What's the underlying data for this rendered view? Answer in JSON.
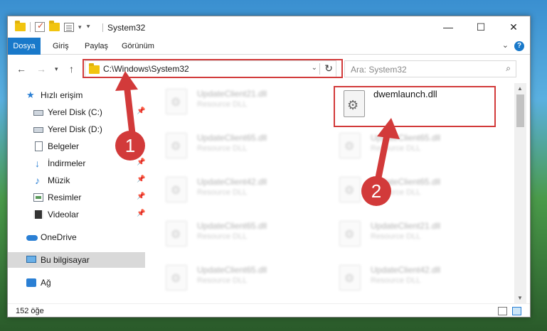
{
  "window": {
    "title": "System32"
  },
  "ribbon": {
    "tabs": [
      "Dosya",
      "Giriş",
      "Paylaş",
      "Görünüm"
    ]
  },
  "address": {
    "path": "C:\\Windows\\System32"
  },
  "search": {
    "placeholder": "Ara: System32"
  },
  "sidebar": {
    "items": [
      {
        "label": "Hızlı erişim",
        "icon": "star-icon"
      },
      {
        "label": "Yerel Disk (C:)",
        "icon": "disk-icon"
      },
      {
        "label": "Yerel Disk (D:)",
        "icon": "disk-icon"
      },
      {
        "label": "Belgeler",
        "icon": "document-icon"
      },
      {
        "label": "İndirmeler",
        "icon": "download-icon"
      },
      {
        "label": "Müzik",
        "icon": "music-icon"
      },
      {
        "label": "Resimler",
        "icon": "pictures-icon"
      },
      {
        "label": "Videolar",
        "icon": "video-icon"
      },
      {
        "label": "OneDrive",
        "icon": "cloud-icon"
      },
      {
        "label": "Bu bilgisayar",
        "icon": "computer-icon"
      },
      {
        "label": "Ağ",
        "icon": "network-icon"
      }
    ]
  },
  "files": {
    "left": [
      {
        "name": "UpdateClient21.dll",
        "type": "Resource DLL"
      },
      {
        "name": "UpdateClient65.dll",
        "type": "Resource DLL"
      },
      {
        "name": "UpdateClient42.dll",
        "type": "Resource DLL"
      },
      {
        "name": "UpdateClient65.dll",
        "type": "Resource DLL"
      },
      {
        "name": "UpdateClient65.dll",
        "type": "Resource DLL"
      }
    ],
    "right": [
      {
        "name": "UpdateClient65.dll",
        "type": "Resource DLL"
      },
      {
        "name": "UpdateClient65.dll",
        "type": "Resource DLL"
      },
      {
        "name": "UpdateClient21.dll",
        "type": "Resource DLL"
      },
      {
        "name": "UpdateClient42.dll",
        "type": "Resource DLL"
      }
    ],
    "target": {
      "name": "dwemlaunch.dll"
    }
  },
  "status": {
    "count": "152 öğe"
  },
  "annotations": {
    "badge1": "1",
    "badge2": "2",
    "color": "#d23a3a"
  }
}
